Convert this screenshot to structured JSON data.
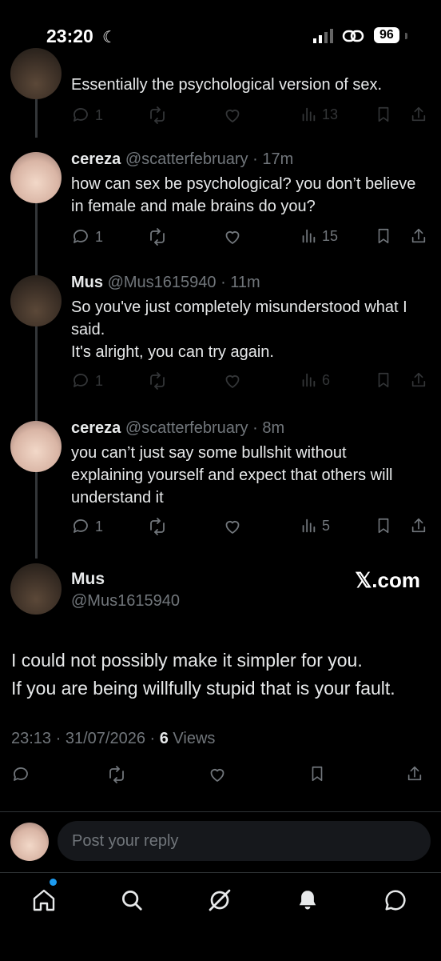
{
  "status_bar": {
    "time": "23:20",
    "battery": "96"
  },
  "thread": [
    {
      "id": "t0",
      "name": "",
      "handle": "",
      "age": "",
      "text": "Essentially the psychological version of sex.",
      "replies": "1",
      "views": "13",
      "dimmed": true
    },
    {
      "id": "t1",
      "name": "cereza",
      "handle": "@scatterfebruary",
      "age": "17m",
      "text": "how can sex be psychological? you don’t believe in female and male brains do you?",
      "replies": "1",
      "views": "15",
      "dimmed": false
    },
    {
      "id": "t2",
      "name": "Mus",
      "handle": "@Mus1615940",
      "age": "11m",
      "text": "So you've just completely misunderstood what I said.\nIt's alright, you can try again.",
      "replies": "1",
      "views": "6",
      "dimmed": true
    },
    {
      "id": "t3",
      "name": "cereza",
      "handle": "@scatterfebruary",
      "age": "8m",
      "text": "you can’t just say some bullshit without explaining yourself and expect that others will understand it",
      "replies": "1",
      "views": "5",
      "dimmed": false
    }
  ],
  "main_post": {
    "name": "Mus",
    "handle": "@Mus1615940",
    "watermark": "𝕏.com",
    "text": "I could not possibly make it simpler for you.\nIf you are being willfully stupid that is your fault.",
    "time": "23:13",
    "date": "31/07/2026",
    "views_count": "6",
    "views_label": "Views"
  },
  "reply": {
    "placeholder": "Post your reply"
  },
  "colors": {
    "accent": "#1d9bf0",
    "muted": "#71767b",
    "text": "#e7e9ea",
    "background": "#000000"
  },
  "nav": [
    "home-icon",
    "search-icon",
    "grok-icon",
    "notifications-icon",
    "messages-icon"
  ]
}
